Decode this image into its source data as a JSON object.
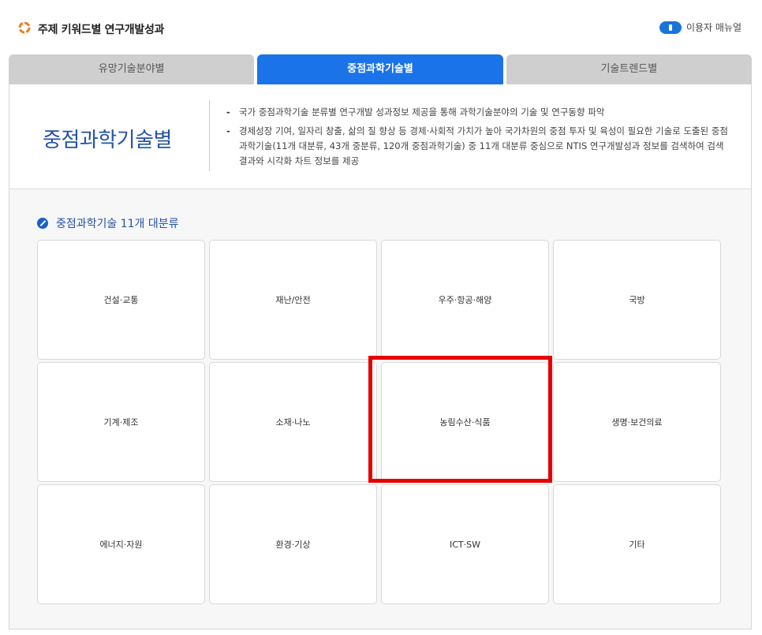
{
  "header": {
    "title": "주제 키워드별 연구개발성과",
    "manual_label": "이용자 매뉴얼"
  },
  "tabs": [
    {
      "label": "유망기술분야별",
      "active": false
    },
    {
      "label": "중점과학기술별",
      "active": true
    },
    {
      "label": "기술트렌드별",
      "active": false
    }
  ],
  "intro": {
    "title": "중점과학기술별",
    "items": [
      "국가 중점과학기술 분류별 연구개발 성과정보 제공을 통해 과학기술분야의 기술 및 연구동향 파악",
      "경제성장 기여, 일자리 창출, 삶의 질 향상 등 경제·사회적 가치가 높아 국가차원의 중점 투자 및 육성이 필요한 기술로 도출된 중점 과학기술(11개 대분류, 43개 중분류, 120개 중점과학기술) 중 11개 대분류 중심으로 NTIS 연구개발성과 정보를 검색하여 검색결과와 시각화 차트 정보를 제공"
    ]
  },
  "section": {
    "title": "중점과학기술 11개 대분류",
    "categories": [
      "건설·교통",
      "재난/안전",
      "우주·항공·해양",
      "국방",
      "기계·제조",
      "소재·나노",
      "농림수산·식품",
      "생명·보건의료",
      "에너지·자원",
      "환경·기상",
      "ICT·SW",
      "기타"
    ]
  },
  "colors": {
    "accent": "#1a73e8",
    "title_blue": "#2452a8",
    "highlight": "#e50000"
  },
  "icons": {
    "logo": "orange-ring-logo-icon",
    "toggle": "manual-toggle-icon",
    "section": "leaf-bullet-icon"
  }
}
